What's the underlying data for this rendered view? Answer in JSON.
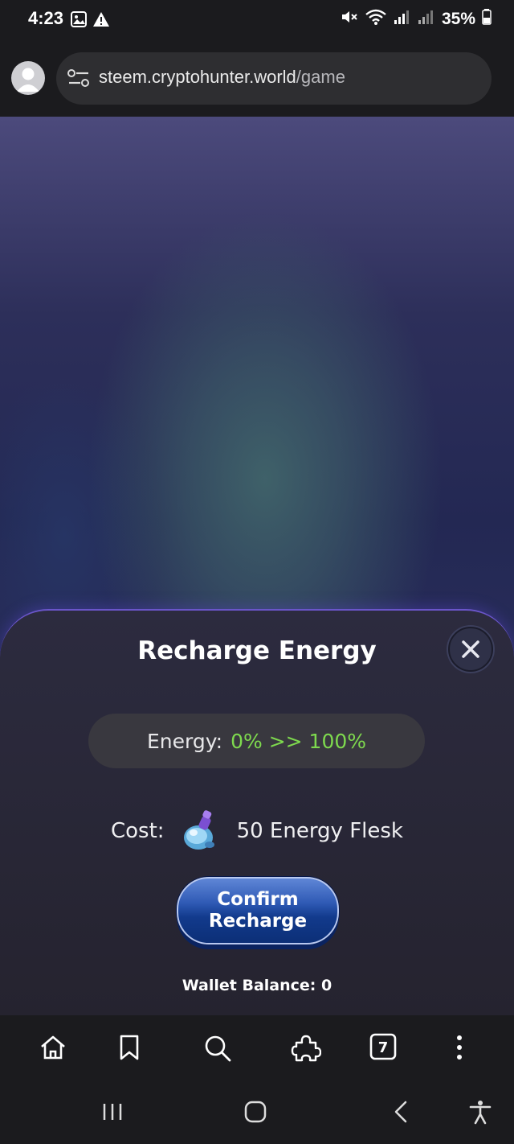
{
  "status_bar": {
    "time": "4:23",
    "battery": "35%"
  },
  "browser": {
    "url_host": "steem.cryptohunter.world",
    "url_path": "/game",
    "tab_count": "7"
  },
  "modal": {
    "title": "Recharge Energy",
    "energy_label": "Energy:",
    "energy_value": "0% >> 100%",
    "cost_label": "Cost:",
    "cost_value": "50 Energy Flesk",
    "confirm_label_line1": "Confirm",
    "confirm_label_line2": "Recharge",
    "wallet_balance": "Wallet Balance: 0"
  },
  "colors": {
    "accent_green": "#7ed94e",
    "button_blue": "#123a8c"
  },
  "icons": {
    "toolbar": [
      "home-icon",
      "bookmark-icon",
      "search-icon",
      "extensions-icon",
      "tabs-icon",
      "more-menu-icon"
    ],
    "nav": [
      "recent-apps-icon",
      "home-nav-icon",
      "back-icon",
      "accessibility-icon"
    ]
  }
}
